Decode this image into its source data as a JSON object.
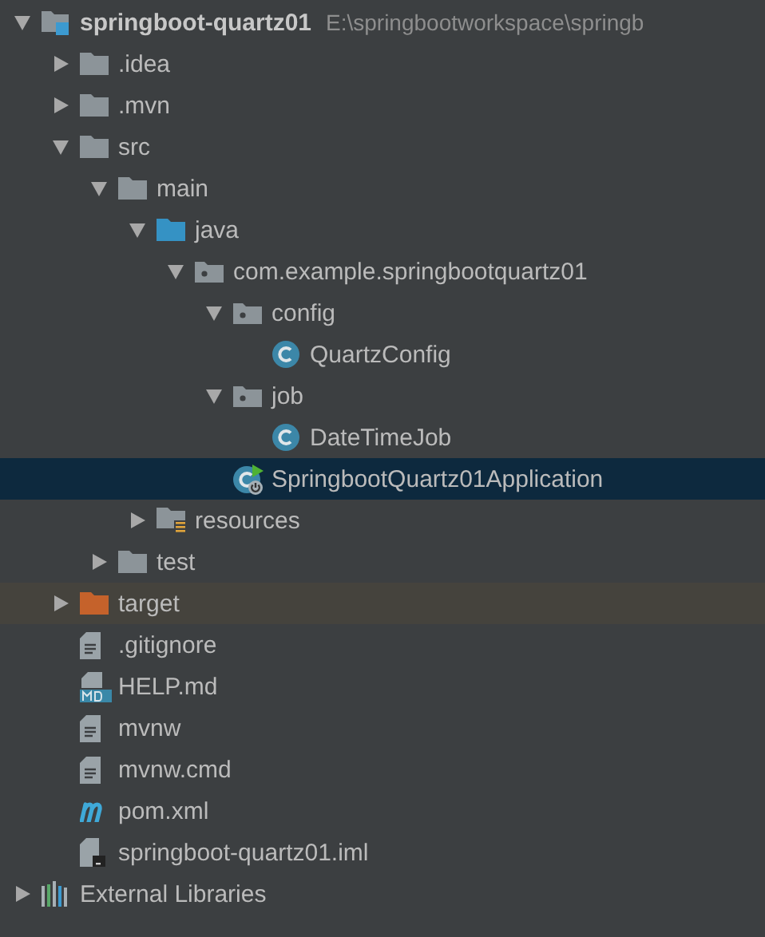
{
  "project_tree": {
    "items": [
      {
        "kind": "module",
        "label": "springboot-quartz01",
        "path": "E:\\springbootworkspace\\springb",
        "expanded": true,
        "selected": false,
        "children": [
          {
            "kind": "folder",
            "label": ".idea",
            "expanded": false,
            "selected": false
          },
          {
            "kind": "folder",
            "label": ".mvn",
            "expanded": false,
            "selected": false
          },
          {
            "kind": "folder",
            "label": "src",
            "expanded": true,
            "selected": false,
            "children": [
              {
                "kind": "folder",
                "label": "main",
                "expanded": true,
                "selected": false,
                "children": [
                  {
                    "kind": "source-folder",
                    "label": "java",
                    "expanded": true,
                    "selected": false,
                    "children": [
                      {
                        "kind": "package",
                        "label": "com.example.springbootquartz01",
                        "expanded": true,
                        "selected": false,
                        "children": [
                          {
                            "kind": "package",
                            "label": "config",
                            "expanded": true,
                            "selected": false,
                            "children": [
                              {
                                "kind": "class",
                                "label": "QuartzConfig",
                                "selected": false
                              }
                            ]
                          },
                          {
                            "kind": "package",
                            "label": "job",
                            "expanded": true,
                            "selected": false,
                            "children": [
                              {
                                "kind": "class",
                                "label": "DateTimeJob",
                                "selected": false
                              }
                            ]
                          },
                          {
                            "kind": "app-class",
                            "label": "SpringbootQuartz01Application",
                            "selected": true
                          }
                        ]
                      }
                    ]
                  },
                  {
                    "kind": "resources",
                    "label": "resources",
                    "expanded": false,
                    "selected": false
                  }
                ]
              },
              {
                "kind": "folder",
                "label": "test",
                "expanded": false,
                "selected": false
              }
            ]
          },
          {
            "kind": "excluded-folder",
            "label": "target",
            "expanded": false,
            "selected": false
          },
          {
            "kind": "file",
            "label": ".gitignore",
            "selected": false
          },
          {
            "kind": "markdown",
            "label": "HELP.md",
            "selected": false
          },
          {
            "kind": "file",
            "label": "mvnw",
            "selected": false
          },
          {
            "kind": "file",
            "label": "mvnw.cmd",
            "selected": false
          },
          {
            "kind": "maven",
            "label": "pom.xml",
            "selected": false
          },
          {
            "kind": "iml",
            "label": "springboot-quartz01.iml",
            "selected": false
          }
        ]
      },
      {
        "kind": "libraries",
        "label": "External Libraries",
        "expanded": false,
        "selected": false
      }
    ]
  }
}
